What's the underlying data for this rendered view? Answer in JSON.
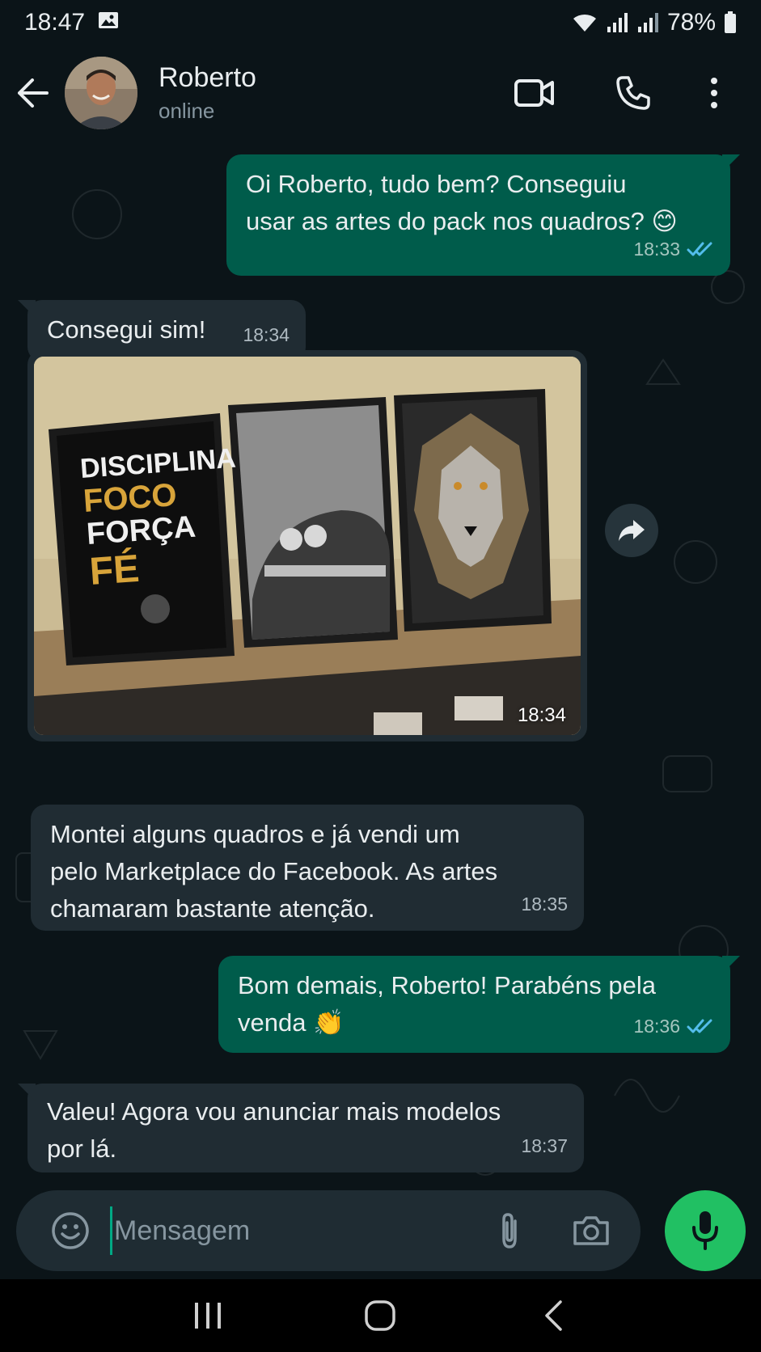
{
  "status_bar": {
    "time": "18:47",
    "battery": "78%"
  },
  "header": {
    "contact_name": "Roberto",
    "contact_status": "online"
  },
  "messages": [
    {
      "direction": "out",
      "text_line1": "Oi Roberto, tudo bem? Conseguiu",
      "text_line2": "usar as artes do pack nos quadros? 😊",
      "time": "18:33",
      "status": "read"
    },
    {
      "direction": "in",
      "text": "Consegui sim!",
      "time": "18:34"
    },
    {
      "direction": "in",
      "type": "image",
      "time": "18:34",
      "poster_lines": [
        "DISCIPLINA",
        "FOCO",
        "FORÇA",
        "FÉ"
      ]
    },
    {
      "direction": "in",
      "text_line1": "Montei alguns quadros e já vendi um",
      "text_line2": "pelo Marketplace do Facebook. As artes",
      "text_line3": "chamaram bastante atenção.",
      "time": "18:35"
    },
    {
      "direction": "out",
      "text_line1": "Bom demais, Roberto! Parabéns pela",
      "text_line2": "venda 👏",
      "time": "18:36",
      "status": "read"
    },
    {
      "direction": "in",
      "text_line1": "Valeu! Agora vou anunciar mais modelos",
      "text_line2": "por lá.",
      "time": "18:37"
    }
  ],
  "composer": {
    "placeholder": "Mensagem"
  },
  "colors": {
    "outgoing_bubble": "#005c4b",
    "incoming_bubble": "#202c33",
    "accent": "#21c063",
    "read_ticks": "#53bdeb"
  }
}
